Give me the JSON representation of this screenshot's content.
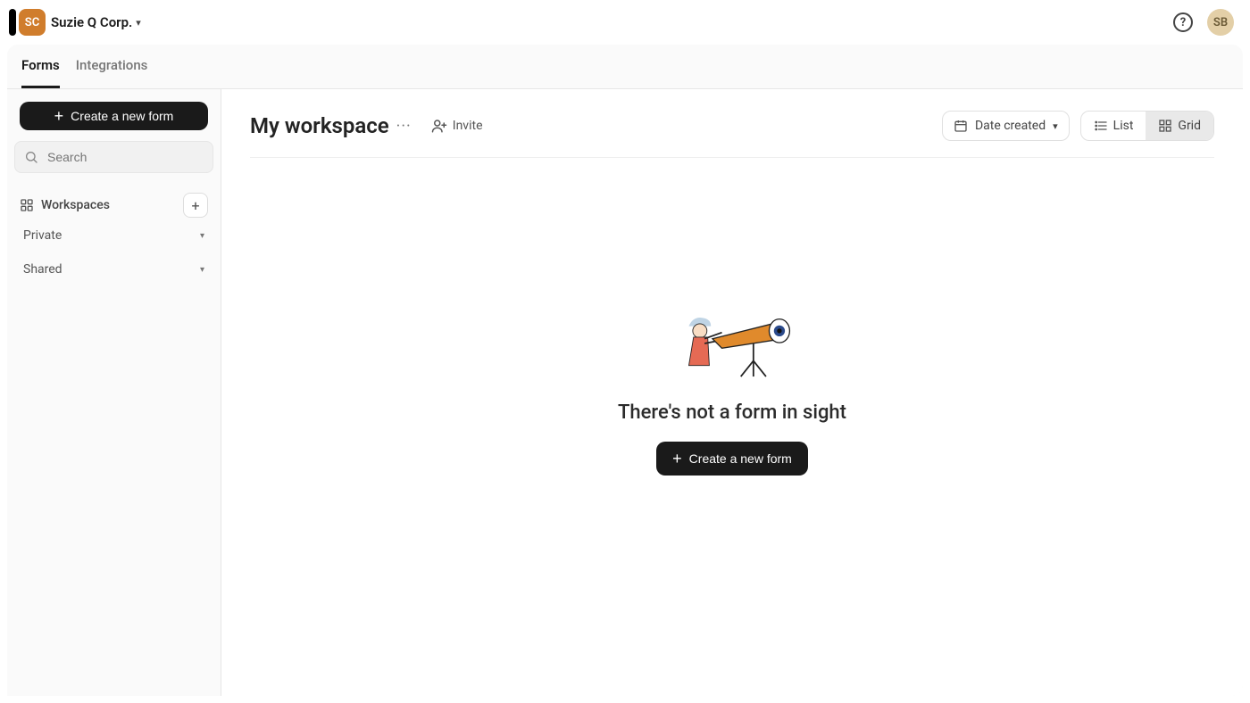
{
  "header": {
    "org_avatar": "SC",
    "org_name": "Suzie Q Corp.",
    "user_avatar": "SB"
  },
  "tabs": {
    "forms": "Forms",
    "integrations": "Integrations",
    "active": "forms"
  },
  "sidebar": {
    "create_label": "Create a new form",
    "search_placeholder": "Search",
    "workspaces_heading": "Workspaces",
    "items": [
      {
        "label": "Private"
      },
      {
        "label": "Shared"
      }
    ]
  },
  "main": {
    "title": "My workspace",
    "invite_label": "Invite",
    "sort": {
      "label": "Date created"
    },
    "view": {
      "list": "List",
      "grid": "Grid",
      "active": "grid"
    },
    "empty": {
      "title": "There's not a form in sight",
      "cta": "Create a new form"
    }
  }
}
